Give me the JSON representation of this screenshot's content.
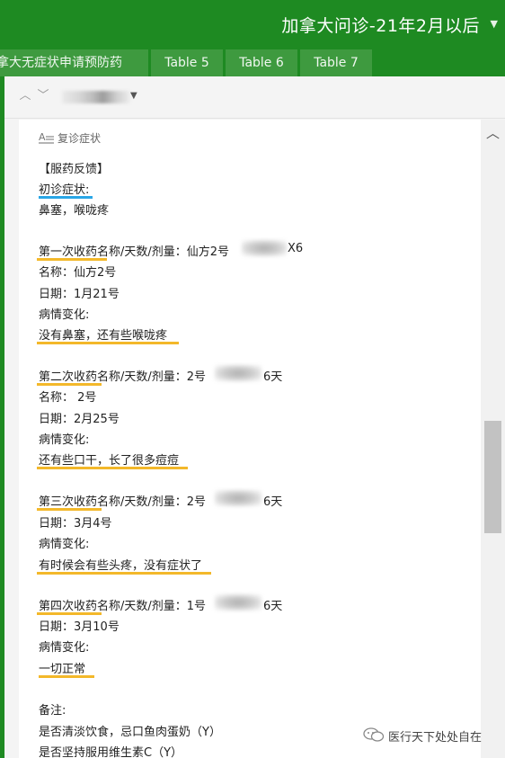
{
  "header": {
    "notebook_title": "加拿大问诊-21年2月以后"
  },
  "tabs": [
    {
      "label": "拿大无症状申请预防药"
    },
    {
      "label": "Table 5"
    },
    {
      "label": "Table 6"
    },
    {
      "label": "Table 7"
    }
  ],
  "note": {
    "section_label": "复诊症状",
    "lines": [
      "【服药反馈】",
      "初诊症状:",
      "鼻塞，喉咙疼",
      "第一次收药名称/天数/剂量：仙方2号",
      "X6",
      "名称：仙方2号",
      "日期：1月21号",
      "病情变化:",
      "没有鼻塞，还有些喉咙疼",
      "第二次收药名称/天数/剂量：2号",
      "6天",
      "名称：  2号",
      "日期：2月25号",
      "病情变化:",
      "还有些口干，长了很多痘痘",
      "第三次收药名称/天数/剂量：2号",
      "6天",
      "日期：3月4号",
      "病情变化:",
      "有时候会有些头疼，没有症状了",
      "第四次收药名称/天数/剂量：1号",
      "6天",
      "日期：3月10号",
      "病情变化:",
      "一切正常",
      "备注:",
      "是否清淡饮食，忌口鱼肉蛋奶（Y）",
      "是否坚持服用维生素C（Y）"
    ]
  },
  "watermark": {
    "text": "医行天下处处自在"
  },
  "colors": {
    "title_bar_green": "#1e8a22",
    "tab_green": "#3e9a3f",
    "underline_yellow": "#f3b82a",
    "underline_blue": "#2aa6e6"
  },
  "icons": {
    "nav_up": "chevron-up-icon",
    "nav_down": "chevron-down-icon",
    "section": "text-format-icon",
    "scroll_up": "scroll-up-icon",
    "watermark": "wechat-icon"
  }
}
